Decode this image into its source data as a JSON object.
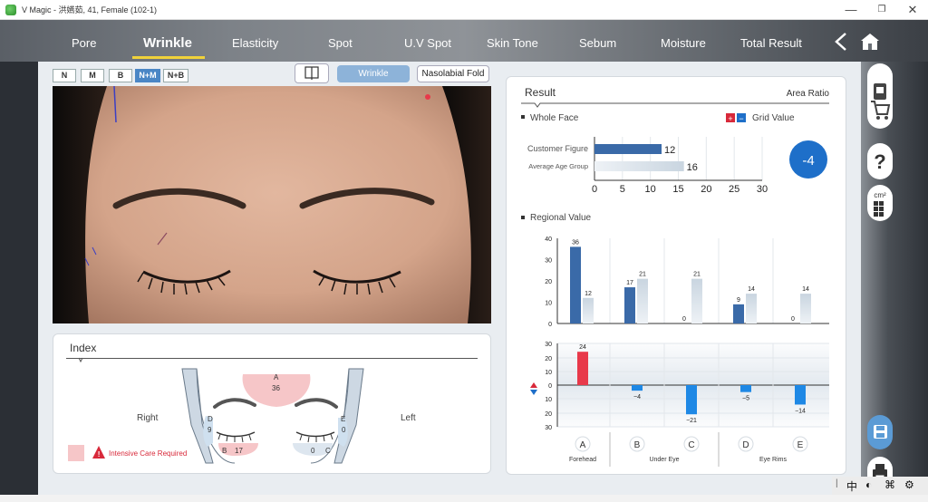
{
  "window": {
    "title": "V Magic - 洪嬿茹, 41, Female (102-1)"
  },
  "nav": {
    "tabs": [
      {
        "label": "Pore"
      },
      {
        "label": "Wrinkle"
      },
      {
        "label": "Elasticity"
      },
      {
        "label": "Spot"
      },
      {
        "label": "U.V Spot"
      },
      {
        "label": "Skin Tone"
      },
      {
        "label": "Sebum"
      },
      {
        "label": "Moisture"
      },
      {
        "label": "Total Result"
      }
    ],
    "active": "Wrinkle"
  },
  "modes": [
    {
      "label": "N"
    },
    {
      "label": "M"
    },
    {
      "label": "B"
    },
    {
      "label": "N+M"
    },
    {
      "label": "N+B"
    }
  ],
  "active_mode": "N+M",
  "toolbar": {
    "wrinkle_label": "Wrinkle",
    "naso_label": "Nasolabial Fold"
  },
  "index": {
    "title": "Index",
    "right_label": "Right",
    "left_label": "Left",
    "zone_a": "A",
    "zone_a_value": "36",
    "zone_b": "B",
    "zone_b_value": "17",
    "zone_c": "C",
    "zone_c_value": "0",
    "zone_d": "D",
    "zone_d_value": "9",
    "zone_e": "E",
    "zone_e_value": "0",
    "legend": "Intensive Care Required"
  },
  "result": {
    "title": "Result",
    "area_ratio": "Area Ratio",
    "whole_face": "Whole Face",
    "grid_value": "Grid Value",
    "grid_plus": "+",
    "grid_minus": "−",
    "customer_label": "Customer Figure",
    "average_label": "Average Age Group",
    "customer_value": "12",
    "average_value": "16",
    "score": "-4",
    "regional": "Regional Value",
    "groups": [
      "Forehead",
      "Under Eye",
      "Eye Rims"
    ]
  },
  "colors": {
    "accent": "#4a86c5",
    "customer": "#3a6aa8",
    "alert": "#e8394a",
    "negative": "#1e88e5"
  },
  "chart_data": [
    {
      "type": "bar",
      "title": "Whole Face",
      "categories": [
        "Customer Figure",
        "Average Age Group"
      ],
      "values": [
        12,
        16
      ],
      "xlim": [
        0,
        30
      ],
      "xticks": [
        0,
        5,
        10,
        15,
        20,
        25,
        30
      ]
    },
    {
      "type": "bar",
      "title": "Regional Value",
      "categories": [
        "A",
        "B",
        "C",
        "D",
        "E"
      ],
      "series": [
        {
          "values": [
            36,
            17,
            0,
            9,
            0
          ]
        },
        {
          "values": [
            12,
            21,
            21,
            14,
            14
          ]
        }
      ],
      "ylim": [
        0,
        40
      ],
      "yticks": [
        0,
        10,
        20,
        30,
        40
      ]
    },
    {
      "type": "bar",
      "categories": [
        "A",
        "B",
        "C",
        "D",
        "E"
      ],
      "values": [
        24,
        -4,
        -21,
        -5,
        -14
      ],
      "value_labels": [
        "24",
        "−4",
        "−21",
        "−5",
        "−14"
      ],
      "ylim": [
        -30,
        30
      ],
      "ytick_labels": [
        "30",
        "20",
        "10",
        "0",
        "10",
        "20",
        "30"
      ]
    }
  ]
}
